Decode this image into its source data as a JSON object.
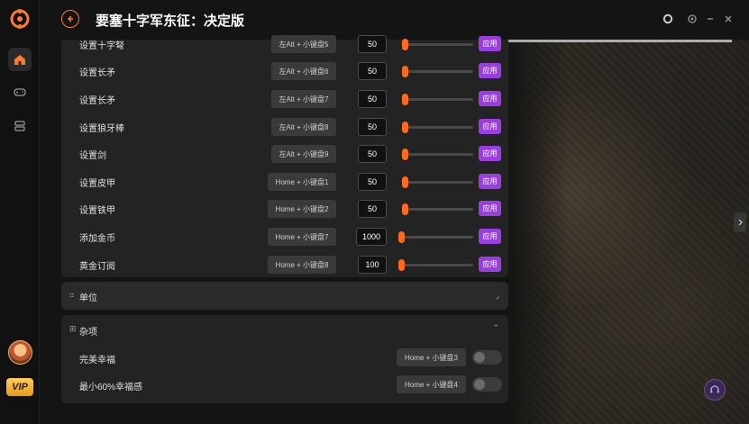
{
  "app": {
    "title": "要塞十字军东征：决定版",
    "vip_label": "VIP"
  },
  "colors": {
    "accent": "#ff6a1f",
    "apply": "#9b3ee0",
    "card": "#232323"
  },
  "icons": {
    "logo": "app-logo-icon",
    "home": "home-icon",
    "gamepad": "gamepad-icon",
    "library": "library-icon",
    "back": "back-arrow-icon",
    "window": [
      "circle-icon",
      "settings-icon",
      "minimize-icon",
      "close-icon"
    ],
    "support": "headset-icon"
  },
  "cheats": {
    "rows": [
      {
        "label": "设置十字弩",
        "hotkey": "左Alt + 小键盘5",
        "value": "50",
        "level": 0,
        "apply": "应用"
      },
      {
        "label": "设置长矛",
        "hotkey": "左Alt + 小键盘6",
        "value": "50",
        "level": 0,
        "apply": "应用"
      },
      {
        "label": "设置长矛",
        "hotkey": "左Alt + 小键盘7",
        "value": "50",
        "level": 0,
        "apply": "应用"
      },
      {
        "label": "设置狼牙棒",
        "hotkey": "左Alt + 小键盘8",
        "value": "50",
        "level": 0,
        "apply": "应用"
      },
      {
        "label": "设置剑",
        "hotkey": "左Alt + 小键盘9",
        "value": "50",
        "level": 0,
        "apply": "应用"
      },
      {
        "label": "设置皮甲",
        "hotkey": "Home + 小键盘1",
        "value": "50",
        "level": 0,
        "apply": "应用"
      },
      {
        "label": "设置铁甲",
        "hotkey": "Home + 小键盘2",
        "value": "50",
        "level": 0,
        "apply": "应用"
      },
      {
        "label": "添加金币",
        "hotkey": "Home + 小键盘7",
        "value": "1000",
        "level": 0,
        "apply": "应用"
      },
      {
        "label": "黄金订阅",
        "hotkey": "Home + 小键盘8",
        "value": "100",
        "level": 0,
        "apply": "应用"
      }
    ]
  },
  "sections": {
    "units": {
      "title": "单位",
      "icon_glyph": "⌗",
      "chevron": "⌟"
    },
    "misc": {
      "title": "杂项",
      "icon_glyph": "⊞",
      "chevron": "⌃"
    }
  },
  "misc": {
    "items": [
      {
        "label": "完美幸福",
        "hotkey": "Home + 小键盘3",
        "on": false
      },
      {
        "label": "最小60%幸福感",
        "hotkey": "Home + 小键盘4",
        "on": false
      }
    ]
  }
}
